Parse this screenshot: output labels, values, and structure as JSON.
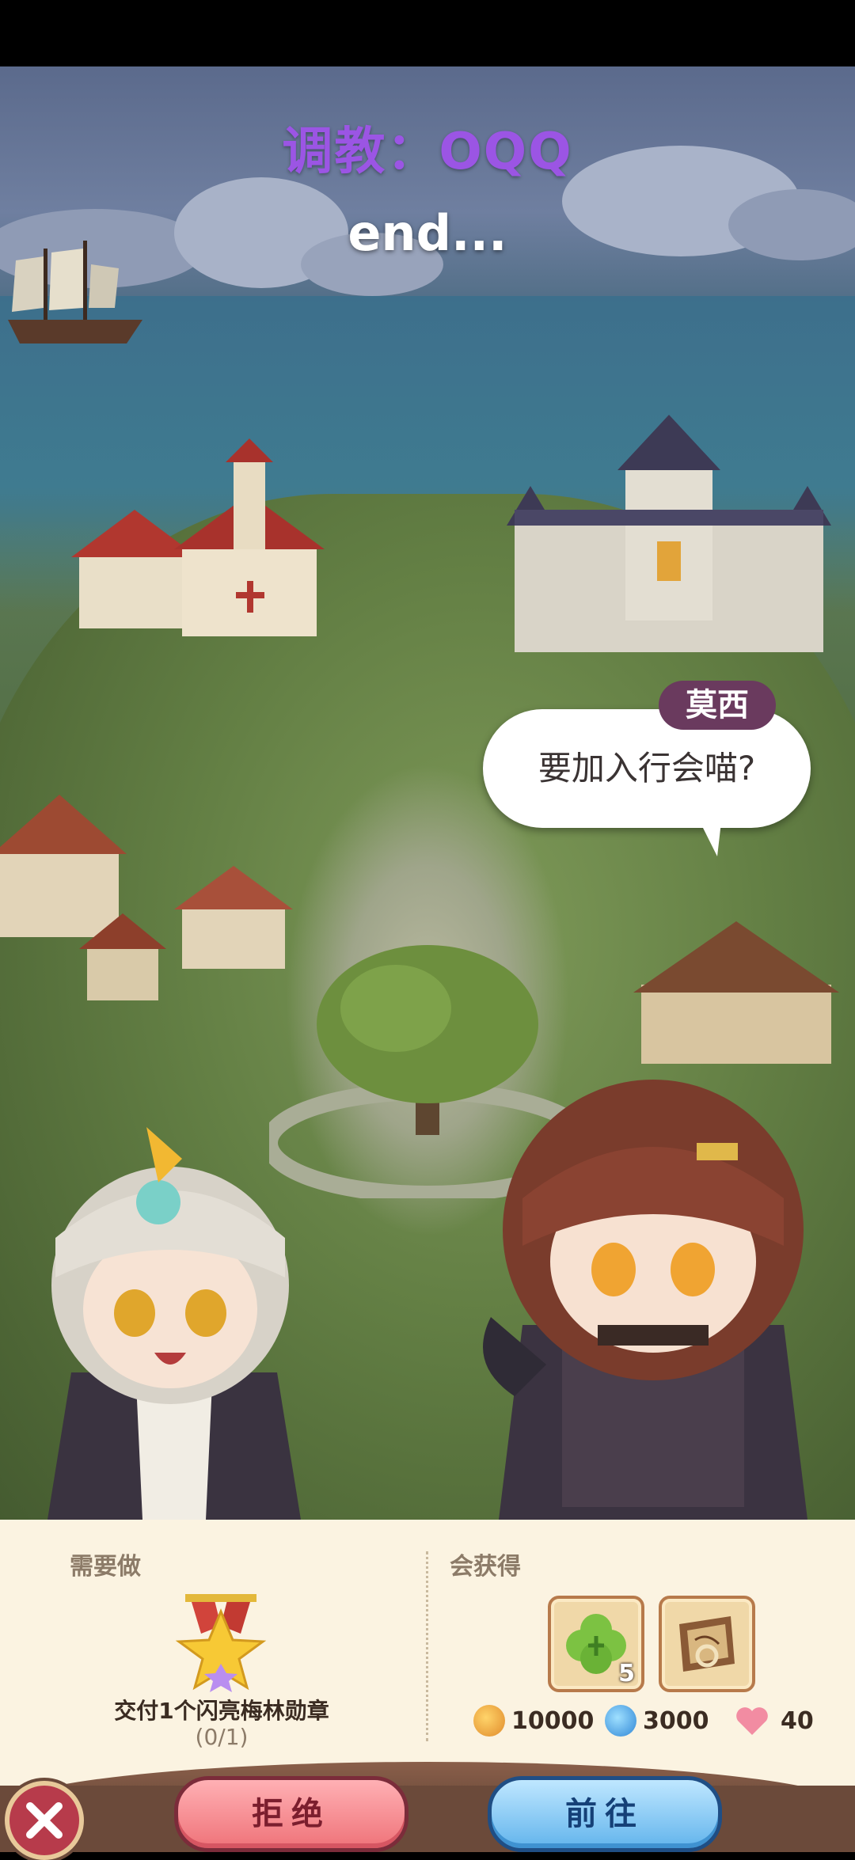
{
  "header": {
    "quest_title": "调教：OQQ",
    "subtitle": "end..."
  },
  "dialog": {
    "speaker": "莫西",
    "line": "要加入行会喵?"
  },
  "task": {
    "section_label": "需要做",
    "medal_icon": "star-medal-icon",
    "description": "交付1个闪亮梅林勋章",
    "progress": "(0/1)"
  },
  "rewards": {
    "section_label": "会获得",
    "items": [
      {
        "icon": "green-clover-item-icon",
        "count": "5"
      },
      {
        "icon": "treasure-map-scroll-icon",
        "count": ""
      }
    ],
    "currencies": [
      {
        "icon": "gold-coin-icon",
        "value": "10000"
      },
      {
        "icon": "blue-drop-coin-icon",
        "value": "3000"
      },
      {
        "icon": "heart-icon",
        "value": "40"
      }
    ]
  },
  "actions": {
    "close_icon": "close-x-icon",
    "reject_label": "拒绝",
    "go_label": "前往"
  }
}
